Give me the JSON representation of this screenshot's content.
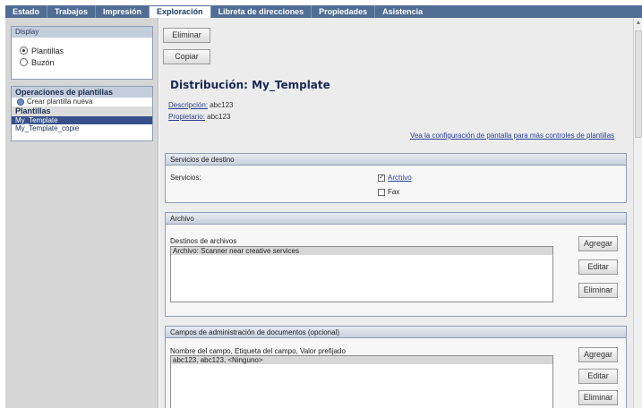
{
  "tabs": [
    {
      "label": "Estado"
    },
    {
      "label": "Trabajos"
    },
    {
      "label": "Impresión"
    },
    {
      "label": "Exploración",
      "active": true
    },
    {
      "label": "Libreta de direcciones"
    },
    {
      "label": "Propiedades"
    },
    {
      "label": "Asistencia"
    }
  ],
  "sidebar": {
    "display_title": "Display",
    "options": [
      "Plantillas",
      "Buzón"
    ],
    "selected_option": "Plantillas",
    "ops_title": "Operaciones de plantillas",
    "create_link": "Crear plantilla nueva",
    "templates_title": "Plantillas",
    "templates": [
      "My_Template",
      "My_Template_copie"
    ],
    "selected_template": "My_Template"
  },
  "main": {
    "delete_button": "Eliminar",
    "copy_button": "Copiar",
    "title": "Distribución: My_Template",
    "description_label": "Descripción:",
    "description_value": "abc123",
    "owner_label": "Propietario:",
    "owner_value": "abc123",
    "config_link": "Vea la configuración de pantalla para más controles de plantillas",
    "services_section": {
      "title": "Servicios de destino",
      "label": "Servicios:",
      "archive": "Archivo",
      "fax": "Fax"
    },
    "archive_section": {
      "title": "Archivo",
      "list_label": "Destinos de archivos",
      "items": [
        "Archivo: Scanner near creative services"
      ],
      "add": "Agregar",
      "edit": "Editar",
      "delete": "Eliminar"
    },
    "fields_section": {
      "title": "Campos de administración de documentos (opcional)",
      "list_label": "Nombre del campo, Etiqueta del campo, Valor prefijado",
      "items": [
        "abc123, abc123, <Ninguno>"
      ],
      "add": "Agregar",
      "edit": "Editar",
      "delete": "Eliminar"
    }
  },
  "colors": {
    "tab_bar": "#4f6d95",
    "selected_item": "#37508a",
    "link": "#2a3fa0"
  }
}
